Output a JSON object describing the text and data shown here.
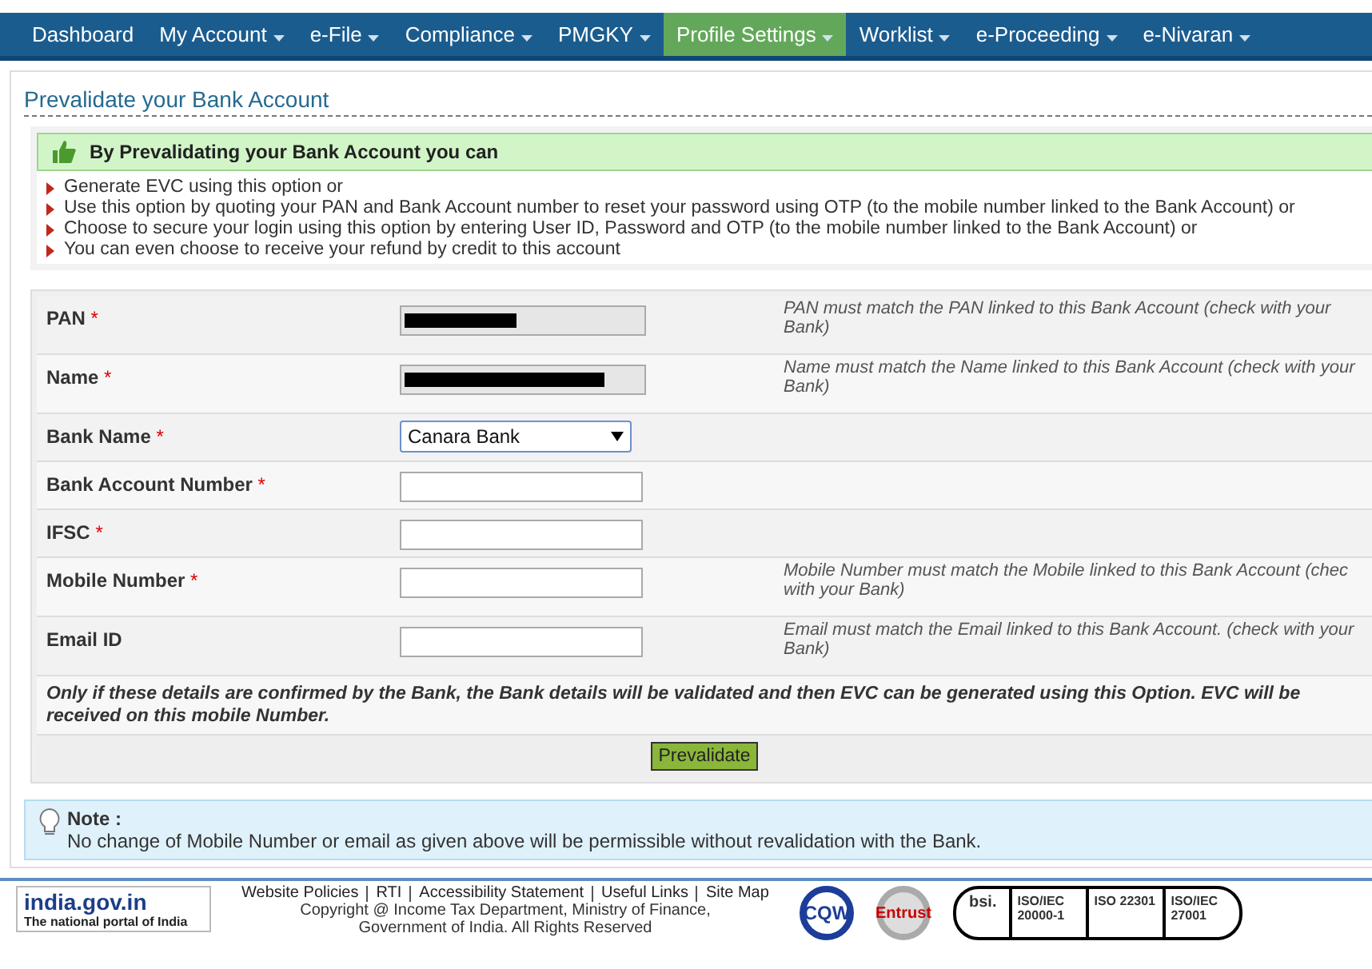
{
  "nav": [
    {
      "label": "Dashboard",
      "dropdown": false,
      "selected": false
    },
    {
      "label": "My Account",
      "dropdown": true,
      "selected": false
    },
    {
      "label": "e-File",
      "dropdown": true,
      "selected": false
    },
    {
      "label": "Compliance",
      "dropdown": true,
      "selected": false
    },
    {
      "label": "PMGKY",
      "dropdown": true,
      "selected": false
    },
    {
      "label": "Profile Settings",
      "dropdown": true,
      "selected": true
    },
    {
      "label": "Worklist",
      "dropdown": true,
      "selected": false
    },
    {
      "label": "e-Proceeding",
      "dropdown": true,
      "selected": false
    },
    {
      "label": "e-Nivaran",
      "dropdown": true,
      "selected": false
    }
  ],
  "page_title": "Prevalidate your Bank Account",
  "benefits": {
    "heading": "By Prevalidating your Bank Account you can",
    "items": [
      "Generate EVC using this option or",
      "Use this option by quoting your PAN and Bank Account number to reset your password using OTP (to the mobile number linked to the Bank Account) or",
      "Choose to secure your login using this option by entering User ID, Password and OTP (to the mobile number linked to the Bank Account) or",
      "You can even choose to receive your refund by credit to this account"
    ]
  },
  "form": {
    "fields": [
      {
        "label": "PAN",
        "marker": "*",
        "kind": "redacted",
        "help": "PAN must match the PAN linked to this Bank Account (check with your Bank)"
      },
      {
        "label": "Name",
        "marker": "*",
        "kind": "redacted",
        "help": "Name must match the Name linked to this Bank Account (check with your Bank)"
      },
      {
        "label": "Bank Name",
        "marker": "*",
        "kind": "select",
        "value": "Canara Bank"
      },
      {
        "label": "Bank Account Number",
        "marker": "*",
        "kind": "text"
      },
      {
        "label": "IFSC",
        "marker": "*",
        "kind": "text"
      },
      {
        "label": "Mobile Number",
        "marker": "*",
        "kind": "text",
        "help": "Mobile Number must match the Mobile linked to this Bank Account (chec with your Bank)"
      },
      {
        "label": "Email ID",
        "kind": "text",
        "help": "Email must match the Email linked to this Bank Account. (check with your Bank)"
      }
    ],
    "notice": "Only if these details are confirmed by the Bank, the Bank details will be validated and then EVC can be generated using this Option. EVC will be received on this mobile Number.",
    "submit": "Prevalidate"
  },
  "note": {
    "title": "Note :",
    "text": "No change of Mobile Number or email as given above will be permissible without revalidation with the Bank."
  },
  "footer": {
    "portal": {
      "name": "india.gov.in",
      "tagline": "The national portal of India"
    },
    "links": [
      "Website Policies",
      "RTI",
      "Accessibility Statement",
      "Useful Links",
      "Site Map"
    ],
    "copyright": [
      "Copyright @ Income Tax Department, Ministry of Finance,",
      "Government of India. All Rights Reserved"
    ],
    "badges": [
      {
        "kind": "cqw",
        "text": "CQW"
      },
      {
        "kind": "entrust",
        "text": "Entrust"
      }
    ],
    "cert_body": "bsi.",
    "certifications": [
      "ISO/IEC 20000-1",
      "ISO 22301",
      "ISO/IEC 27001"
    ]
  }
}
